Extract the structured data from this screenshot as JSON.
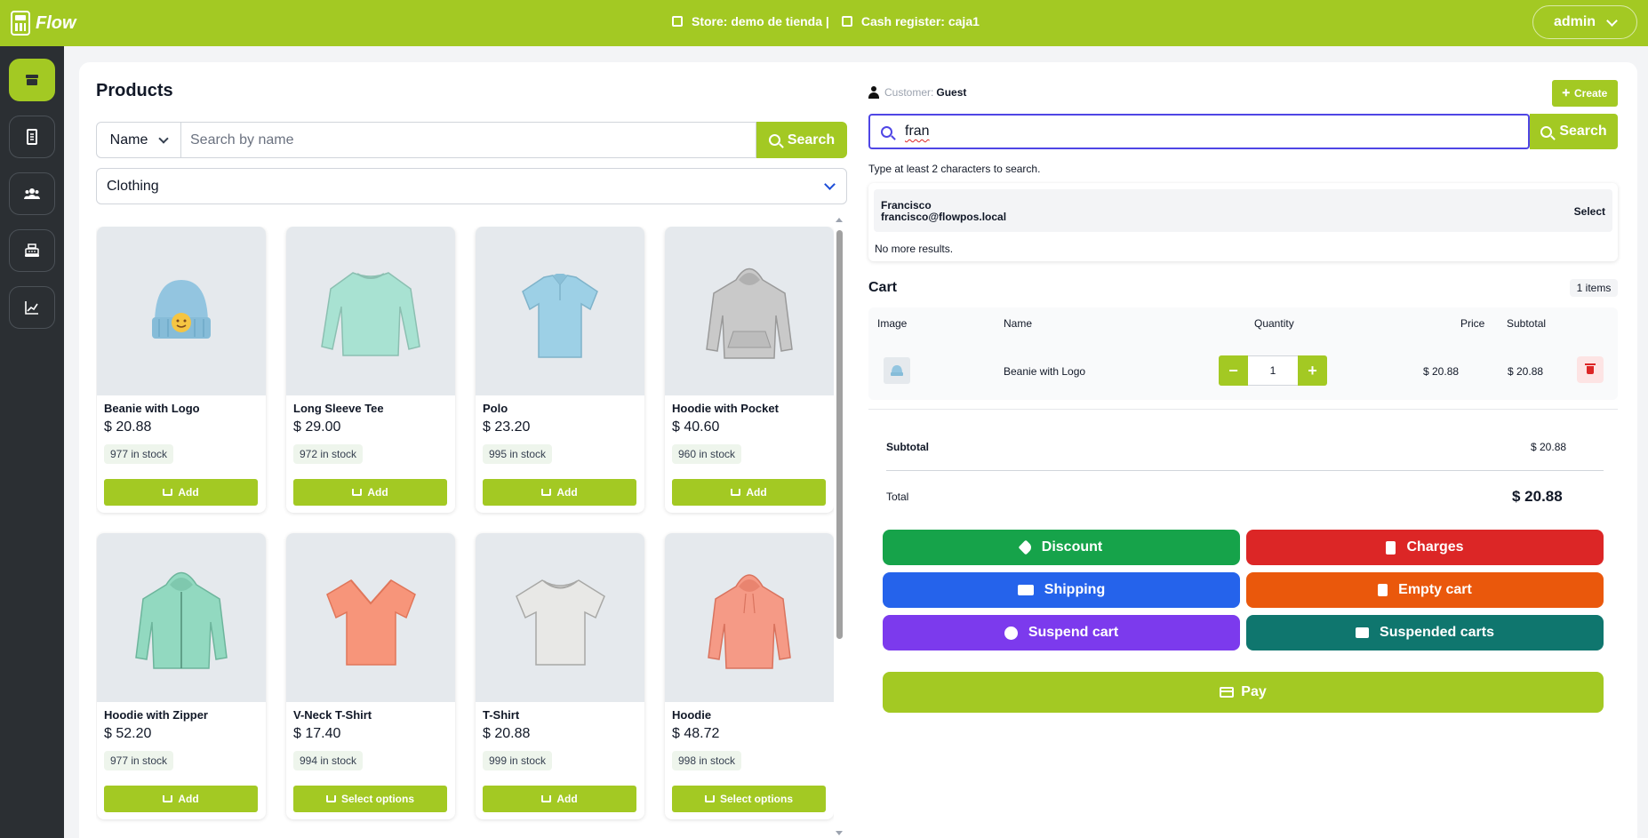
{
  "app": {
    "name": "Flow"
  },
  "header": {
    "store": "Store: demo de tienda |",
    "register": "Cash register: caja1",
    "user": "admin"
  },
  "sidebar": {
    "items": [
      {
        "icon": "store-icon",
        "active": true
      },
      {
        "icon": "receipt-icon",
        "active": false
      },
      {
        "icon": "users-icon",
        "active": false
      },
      {
        "icon": "cash-register-icon",
        "active": false
      },
      {
        "icon": "chart-icon",
        "active": false
      }
    ]
  },
  "products": {
    "title": "Products",
    "search_field": "Name",
    "search_placeholder": "Search by name",
    "search_button": "Search",
    "category": "Clothing",
    "items": [
      {
        "name": "Beanie with Logo",
        "price": "$ 20.88",
        "stock": "977 in stock",
        "action": "Add"
      },
      {
        "name": "Long Sleeve Tee",
        "price": "$ 29.00",
        "stock": "972 in stock",
        "action": "Add"
      },
      {
        "name": "Polo",
        "price": "$ 23.20",
        "stock": "995 in stock",
        "action": "Add"
      },
      {
        "name": "Hoodie with Pocket",
        "price": "$ 40.60",
        "stock": "960 in stock",
        "action": "Add"
      },
      {
        "name": "Hoodie with Zipper",
        "price": "$ 52.20",
        "stock": "977 in stock",
        "action": "Add"
      },
      {
        "name": "V-Neck T-Shirt",
        "price": "$ 17.40",
        "stock": "994 in stock",
        "action": "Select options"
      },
      {
        "name": "T-Shirt",
        "price": "$ 20.88",
        "stock": "999 in stock",
        "action": "Add"
      },
      {
        "name": "Hoodie",
        "price": "$ 48.72",
        "stock": "998 in stock",
        "action": "Select options"
      }
    ]
  },
  "customer": {
    "label": "Customer:",
    "value": "Guest",
    "create_button": "Create",
    "search_value": "fran",
    "search_button": "Search",
    "hint": "Type at least 2 characters to search.",
    "results": [
      {
        "name": "Francisco",
        "email": "francisco@flowpos.local",
        "action": "Select"
      }
    ],
    "no_more": "No more results."
  },
  "cart": {
    "title": "Cart",
    "count": "1 items",
    "headers": {
      "image": "Image",
      "name": "Name",
      "quantity": "Quantity",
      "price": "Price",
      "subtotal": "Subtotal"
    },
    "rows": [
      {
        "name": "Beanie with Logo",
        "quantity": "1",
        "price": "$ 20.88",
        "subtotal": "$ 20.88"
      }
    ],
    "subtotal_label": "Subtotal",
    "subtotal_value": "$ 20.88",
    "total_label": "Total",
    "total_value": "$ 20.88"
  },
  "actions": {
    "discount": "Discount",
    "charges": "Charges",
    "shipping": "Shipping",
    "empty_cart": "Empty cart",
    "suspend_cart": "Suspend cart",
    "suspended_carts": "Suspended carts",
    "pay": "Pay"
  },
  "colors": {
    "brand": "#a3c923",
    "sidebar": "#2b2f33",
    "discount": "#16a34a",
    "charges": "#dc2626",
    "shipping": "#2563eb",
    "empty_cart": "#ea580c",
    "suspend_cart": "#7c3aed",
    "suspended_carts": "#0f766e"
  }
}
